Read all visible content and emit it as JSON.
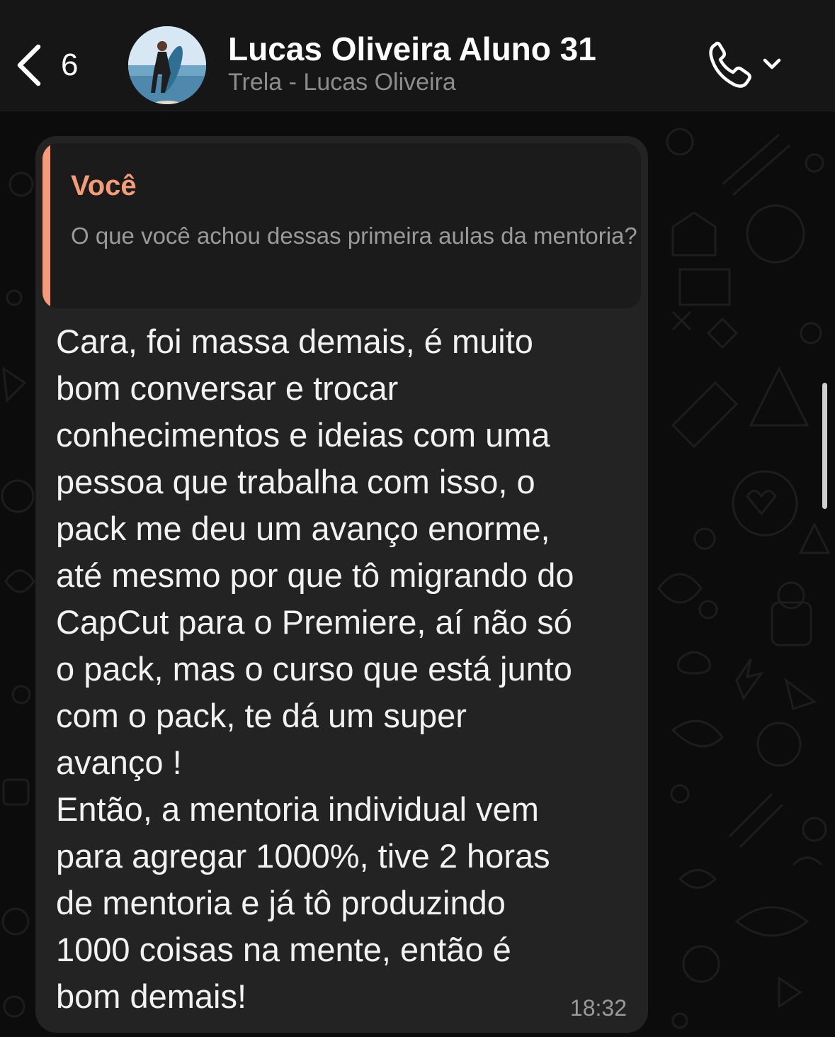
{
  "header": {
    "unread_count": "6",
    "contact_name": "Lucas Oliveira Aluno 31",
    "contact_subtitle": "Trela - Lucas Oliveira",
    "icons": {
      "back": "chevron-left-icon",
      "call": "phone-icon",
      "call_menu": "chevron-down-icon"
    }
  },
  "message": {
    "quote": {
      "author": "Você",
      "text": "O que você achou dessas primeira aulas da mentoria?"
    },
    "text": "Cara, foi massa demais, é muito\nbom conversar e trocar\nconhecimentos e ideias com uma\npessoa que trabalha com isso, o\npack me deu um avanço enorme,\naté mesmo por que tô migrando do\nCapCut para o Premiere, aí não só\no pack, mas o curso que está junto\ncom o pack, te dá um super\navanço !\nEntão, a mentoria individual vem\npara agregar 1000%, tive 2 horas\nde mentoria e já tô produzindo\n1000 coisas na mente, então é\nbom demais!",
    "time": "18:32"
  },
  "colors": {
    "quote_accent": "#f49b7a",
    "bubble": "#232323",
    "header_bg": "#161616"
  }
}
